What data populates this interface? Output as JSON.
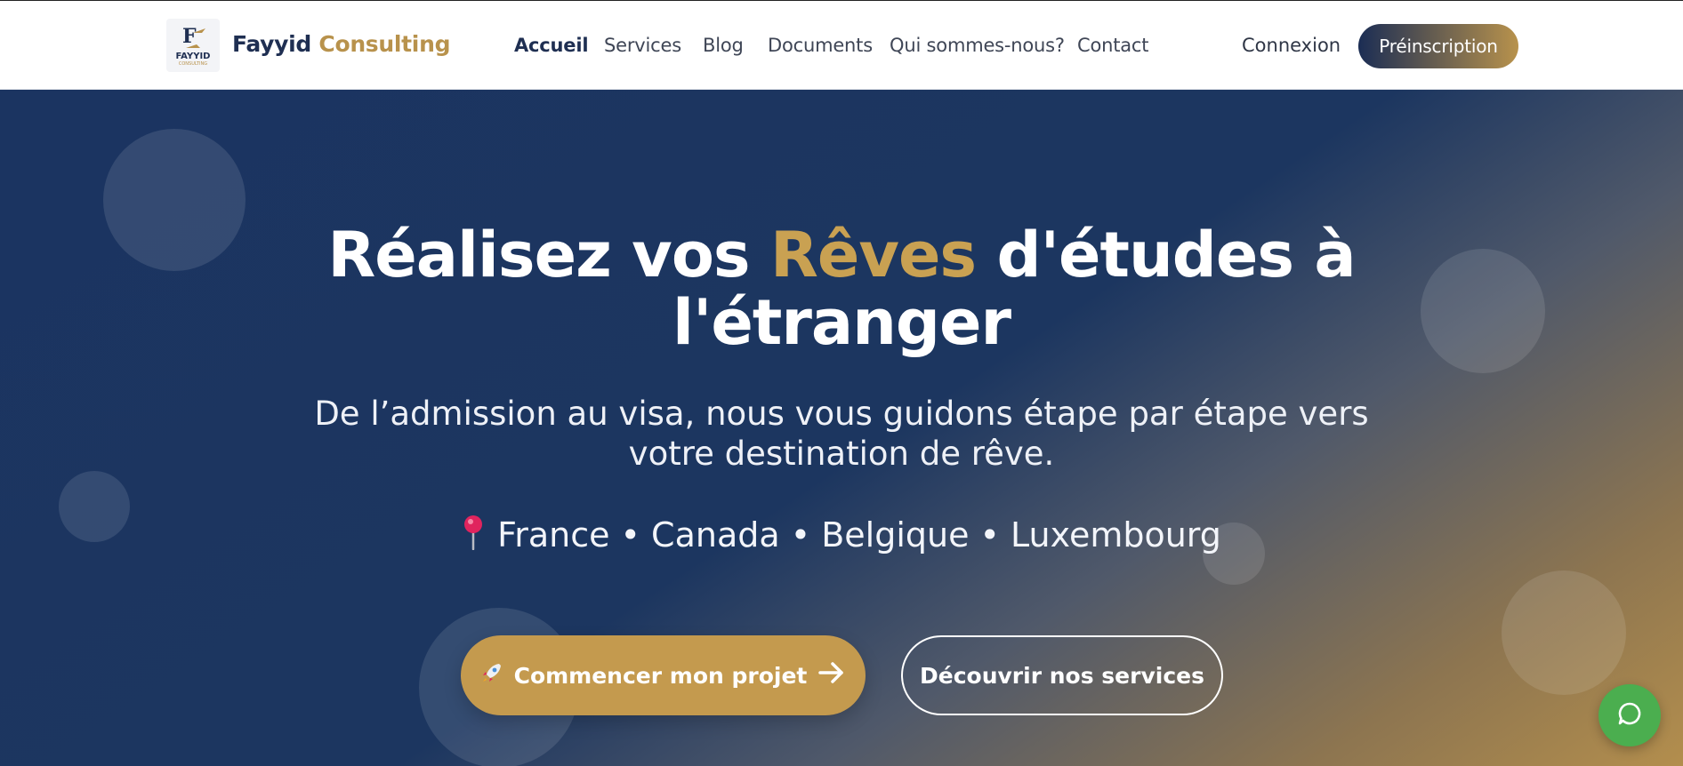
{
  "header": {
    "logo": {
      "icon": "fayyid-logo-icon",
      "wordmark": "FAYYID",
      "tagline": "CONSULTING"
    },
    "brand": {
      "first": "Fayyid",
      "second": "Consulting"
    },
    "nav": [
      {
        "label": "Accueil",
        "active": true
      },
      {
        "label": "Services",
        "active": false
      },
      {
        "label": "Blog",
        "active": false
      },
      {
        "label": "Documents",
        "active": false
      },
      {
        "label": "Qui sommes-nous?",
        "active": false
      },
      {
        "label": "Contact",
        "active": false
      }
    ],
    "login_label": "Connexion",
    "cta_label": "Préinscription"
  },
  "hero": {
    "title_before": "Réalisez vos",
    "title_highlight": "Rêves",
    "title_after": "d'études à l'étranger",
    "subtitle": "De l’admission au visa, nous vous guidons étape par étape vers votre destination de rêve.",
    "countries_icon": "map-pin-icon",
    "countries": "France • Canada • Belgique • Luxembourg",
    "primary_button": {
      "icon": "rocket-icon",
      "label": "Commencer mon projet",
      "trailing_icon": "arrow-right-icon"
    },
    "secondary_button": {
      "label": "Découvrir nos services"
    }
  },
  "chat_widget": {
    "icon": "chat-bubble-icon"
  },
  "colors": {
    "navy": "#1c355e",
    "gold": "#c49a4e",
    "gold_text": "#c9a152",
    "chat_green": "#4bae4f"
  }
}
